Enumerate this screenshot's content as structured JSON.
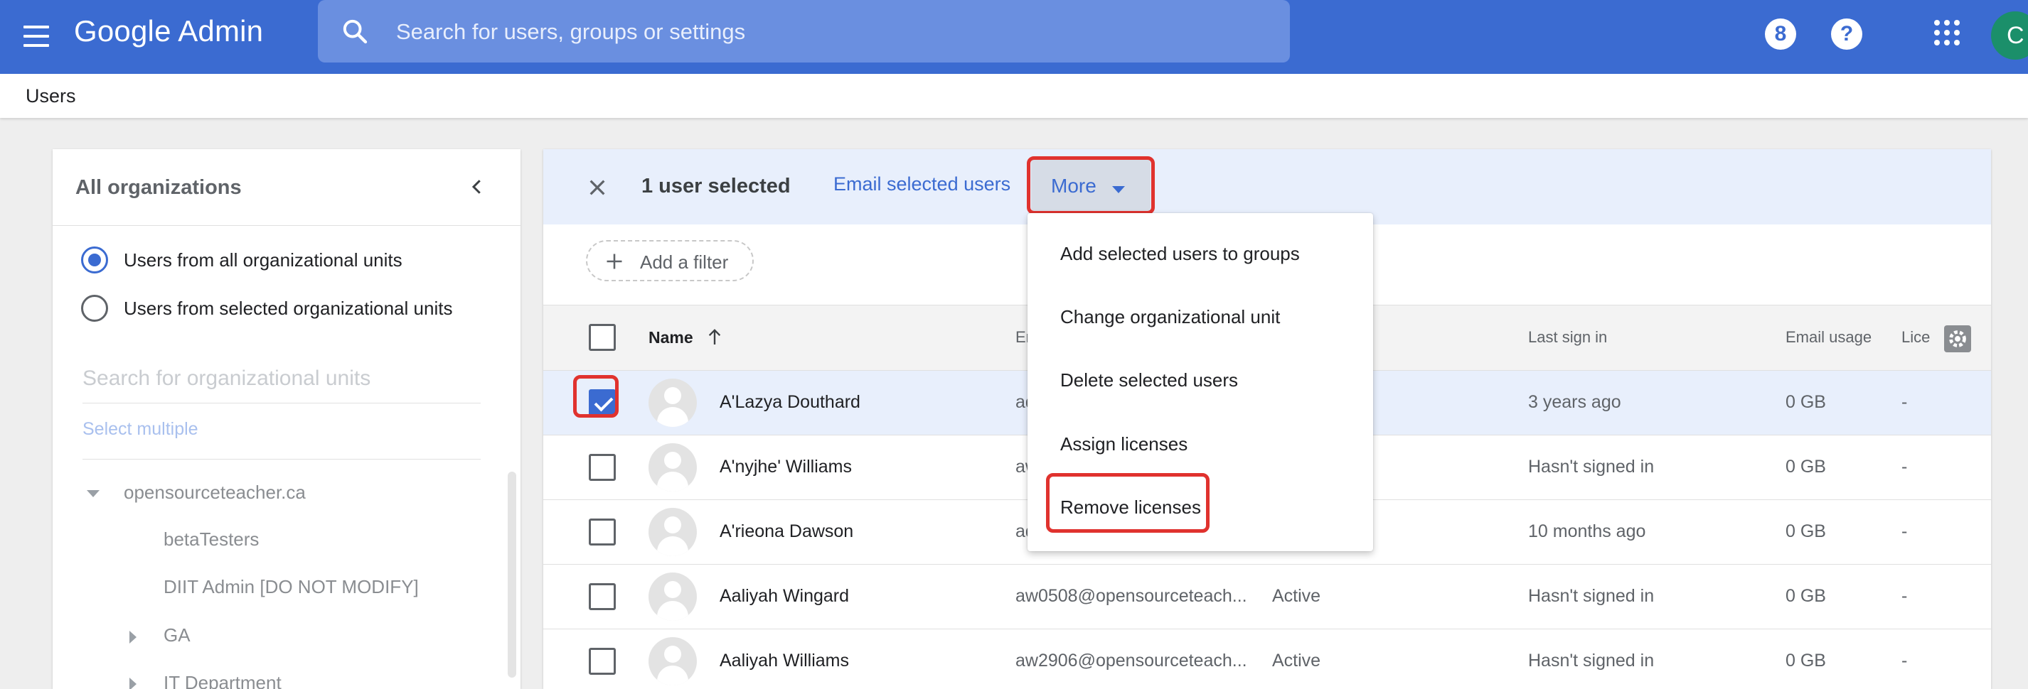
{
  "header": {
    "app_name_bold": "Google",
    "app_name_rest": " Admin",
    "search_placeholder": "Search for users, groups or settings",
    "notification_glyph": "8",
    "help_glyph": "?",
    "account_initial": "C",
    "icons": [
      "menu-icon",
      "search-icon",
      "notification-icon",
      "help-icon",
      "apps-icon",
      "account-avatar"
    ]
  },
  "breadcrumb": {
    "label": "Users"
  },
  "org_panel": {
    "title": "All organizations",
    "radio_options": [
      {
        "label": "Users from all organizational units",
        "selected": true
      },
      {
        "label": "Users from selected organizational units",
        "selected": false
      }
    ],
    "search_placeholder": "Search for organizational units",
    "select_multiple": "Select multiple",
    "tree": [
      {
        "label": "opensourceteacher.ca",
        "expanded": true
      },
      {
        "label": "betaTesters"
      },
      {
        "label": "DIIT Admin [DO NOT MODIFY]"
      },
      {
        "label": "GA",
        "collapsed": true
      },
      {
        "label": "IT Department",
        "collapsed": true
      }
    ]
  },
  "selection_bar": {
    "count_label": "1 user selected",
    "email_label": "Email selected users",
    "more_label": "More"
  },
  "filter": {
    "label": "Add a filter"
  },
  "table": {
    "headers": {
      "name": "Name",
      "email": "Em",
      "last_sign_in": "Last sign in",
      "email_usage": "Email usage",
      "licenses": "Lice"
    },
    "rows": [
      {
        "name": "A'Lazya Douthard",
        "email": "ad",
        "status": "",
        "last_sign_in": "3 years ago",
        "email_usage": "0 GB",
        "licenses": "-",
        "checked": true
      },
      {
        "name": "A'nyjhe' Williams",
        "email": "aw",
        "status": "",
        "last_sign_in": "Hasn't signed in",
        "email_usage": "0 GB",
        "licenses": "-",
        "checked": false
      },
      {
        "name": "A'rieona Dawson",
        "email": "ad",
        "status": "",
        "last_sign_in": "10 months ago",
        "email_usage": "0 GB",
        "licenses": "-",
        "checked": false
      },
      {
        "name": "Aaliyah Wingard",
        "email": "aw0508@opensourceteach...",
        "status": "Active",
        "last_sign_in": "Hasn't signed in",
        "email_usage": "0 GB",
        "licenses": "-",
        "checked": false
      },
      {
        "name": "Aaliyah Williams",
        "email": "aw2906@opensourceteach...",
        "status": "Active",
        "last_sign_in": "Hasn't signed in",
        "email_usage": "0 GB",
        "licenses": "-",
        "checked": false
      }
    ]
  },
  "more_menu": {
    "items": [
      "Add selected users to groups",
      "Change organizational unit",
      "Delete selected users",
      "Assign licenses",
      "Remove licenses"
    ]
  },
  "colors": {
    "brand": "#3b6bd1",
    "highlight": "#e0322e",
    "selected_row": "#e8effc"
  }
}
